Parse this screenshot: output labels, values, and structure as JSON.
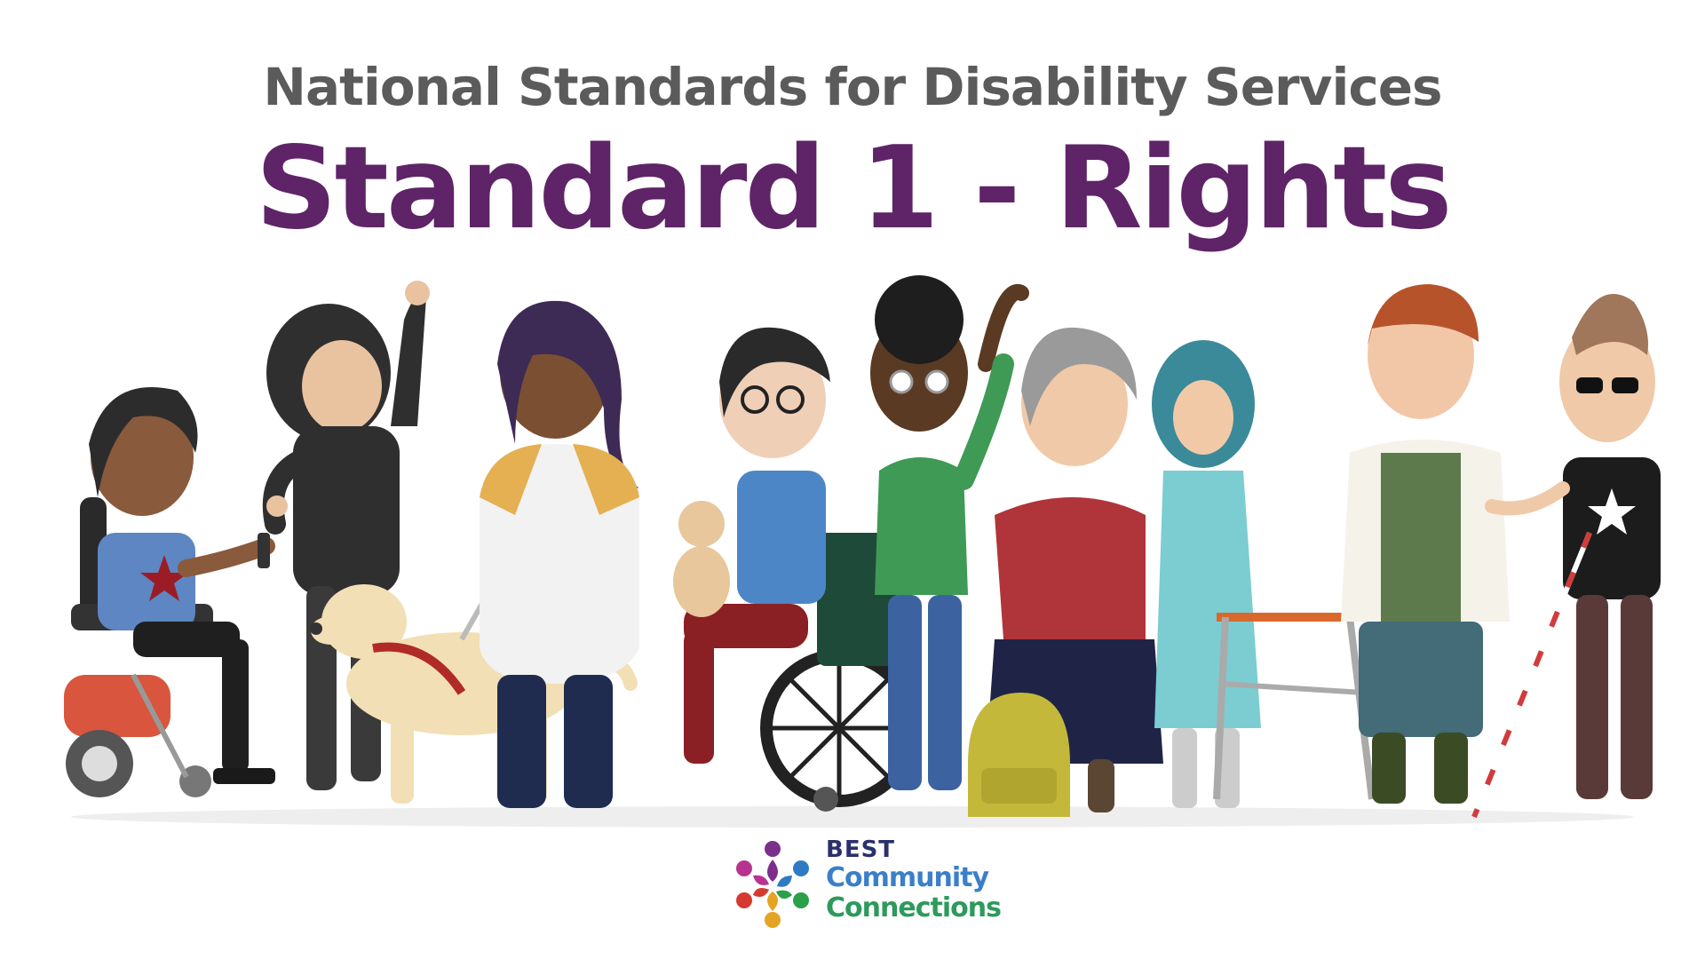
{
  "header": {
    "subtitle": "National Standards for Disability Services",
    "title": "Standard 1 - Rights"
  },
  "logo": {
    "best": "BEST",
    "line1": "Community",
    "line2": "Connections"
  },
  "colors": {
    "title": "#5e2467",
    "subtitle": "#5b5b5b",
    "background": "#ffffff"
  },
  "illustration": {
    "figures": [
      "person-in-power-wheelchair",
      "person-in-black-hoodie",
      "guide-dog",
      "person-with-long-hair",
      "person-in-manual-wheelchair-with-cat",
      "person-with-glasses-waving",
      "older-woman-in-red-sweater",
      "backpack",
      "woman-in-hijab-with-walker",
      "man-in-checked-shirt",
      "man-with-white-cane"
    ]
  }
}
